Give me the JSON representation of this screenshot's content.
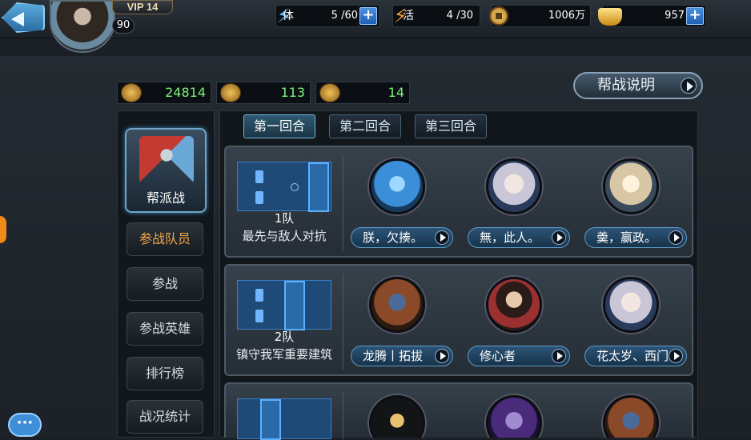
{
  "header": {
    "vip_label": "VIP 14",
    "level": "90",
    "stamina": {
      "icon": "lightning-icon",
      "label": "体",
      "value": "5 /60"
    },
    "vigor": {
      "icon": "lightning-icon",
      "label": "活",
      "value": "4 /30"
    },
    "coins": {
      "icon": "coin-icon",
      "value": "1006万"
    },
    "ingots": {
      "icon": "gold-ingot-icon",
      "value": "957"
    }
  },
  "resources": [
    {
      "icon": "medal-icon",
      "value": "24814"
    },
    {
      "icon": "demon-mask-icon",
      "value": "113"
    },
    {
      "icon": "crossed-swords-icon",
      "value": "14"
    }
  ],
  "explain_button": "帮战说明",
  "sidebar": {
    "guild_war_label": "帮派战",
    "items": [
      {
        "label": "参战队员",
        "active": true
      },
      {
        "label": "参战",
        "active": false
      },
      {
        "label": "参战英雄",
        "active": false
      },
      {
        "label": "排行榜",
        "active": false
      },
      {
        "label": "战况统计",
        "active": false
      }
    ]
  },
  "tabs": [
    {
      "label": "第一回合",
      "active": true
    },
    {
      "label": "第二回合",
      "active": false
    },
    {
      "label": "第三回合",
      "active": false
    }
  ],
  "teams": [
    {
      "name": "1队",
      "desc": "最先与敌人对抗",
      "heroes": [
        {
          "name": "朕，欠揍。",
          "color": "#3a8fd8"
        },
        {
          "name": "無，此人。",
          "color": "#c9c6d8"
        },
        {
          "name": "羮，嬴政。",
          "color": "#d8c6a4"
        }
      ]
    },
    {
      "name": "2队",
      "desc": "镇守我军重要建筑",
      "heroes": [
        {
          "name": "龙腾丨拓拔",
          "color": "#8a4a2a"
        },
        {
          "name": "修心者",
          "color": "#9a3030"
        },
        {
          "name": "花太岁、西门",
          "color": "#c9c6d8"
        }
      ]
    }
  ],
  "colors": {
    "accent": "#6fb9e0",
    "active_nav": "#f2a64a",
    "resource_value": "#7ff07a"
  }
}
